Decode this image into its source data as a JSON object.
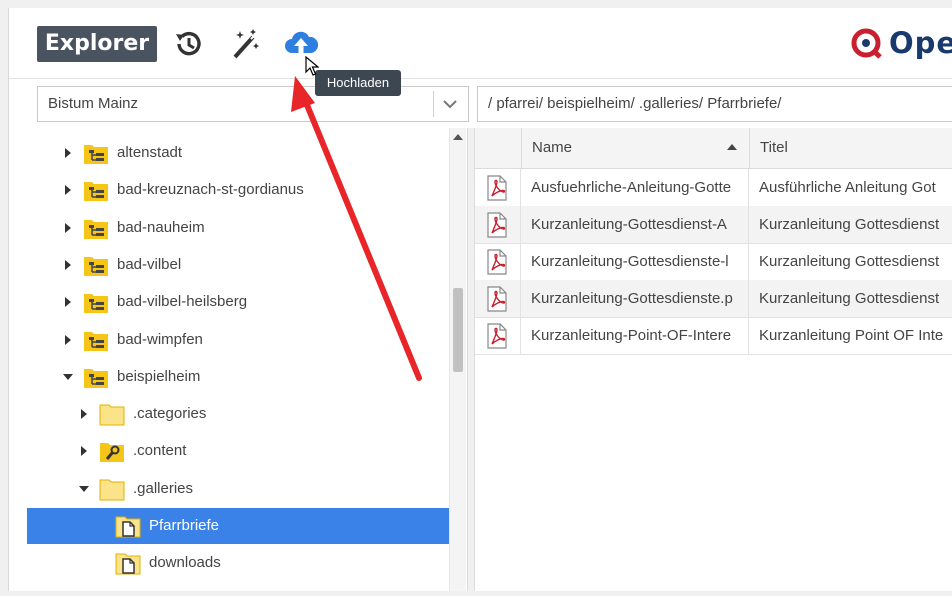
{
  "toolbar": {
    "explorer_label": "Explorer",
    "history_icon": "history-icon",
    "wand_icon": "magic-wand-icon",
    "upload_icon": "cloud-upload-icon",
    "logo_text": "OpenCms",
    "tooltip": "Hochladen"
  },
  "site_select": {
    "value": "Bistum Mainz"
  },
  "path_input": {
    "value": "/ pfarrei/ beispielheim/ .galleries/ Pfarrbriefe/"
  },
  "tree": {
    "items": [
      {
        "label": "altenstadt",
        "icon": "site-folder-icon",
        "expanded": false
      },
      {
        "label": "bad-kreuznach-st-gordianus",
        "icon": "site-folder-icon",
        "expanded": false
      },
      {
        "label": "bad-nauheim",
        "icon": "site-folder-icon",
        "expanded": false
      },
      {
        "label": "bad-vilbel",
        "icon": "site-folder-icon",
        "expanded": false
      },
      {
        "label": "bad-vilbel-heilsberg",
        "icon": "site-folder-icon",
        "expanded": false
      },
      {
        "label": "bad-wimpfen",
        "icon": "site-folder-icon",
        "expanded": false
      },
      {
        "label": "beispielheim",
        "icon": "site-folder-icon",
        "expanded": true
      },
      {
        "label": ".categories",
        "icon": "folder-icon",
        "expanded": false
      },
      {
        "label": ".content",
        "icon": "content-folder-icon",
        "expanded": false
      },
      {
        "label": ".galleries",
        "icon": "folder-icon",
        "expanded": true
      },
      {
        "label": "Pfarrbriefe",
        "icon": "gallery-folder-icon",
        "selected": true
      },
      {
        "label": "downloads",
        "icon": "gallery-folder-icon"
      }
    ]
  },
  "table": {
    "headers": {
      "name": "Name",
      "title": "Titel"
    },
    "rows": [
      {
        "name": "Ausfuehrliche-Anleitung-Gotte",
        "title": "Ausführliche Anleitung Got"
      },
      {
        "name": "Kurzanleitung-Gottesdienst-A",
        "title": "Kurzanleitung Gottesdienst"
      },
      {
        "name": "Kurzanleitung-Gottesdienste-l",
        "title": "Kurzanleitung Gottesdienst"
      },
      {
        "name": "Kurzanleitung-Gottesdienste.p",
        "title": "Kurzanleitung Gottesdienst"
      },
      {
        "name": "Kurzanleitung-Point-OF-Intere",
        "title": "Kurzanleitung Point OF Inte"
      }
    ]
  },
  "colors": {
    "toolbar_button": "#4a5360",
    "selection": "#3b82e8",
    "folder": "#f5c518",
    "annotation_arrow": "#e8262a",
    "upload_icon": "#2f7fe0"
  }
}
